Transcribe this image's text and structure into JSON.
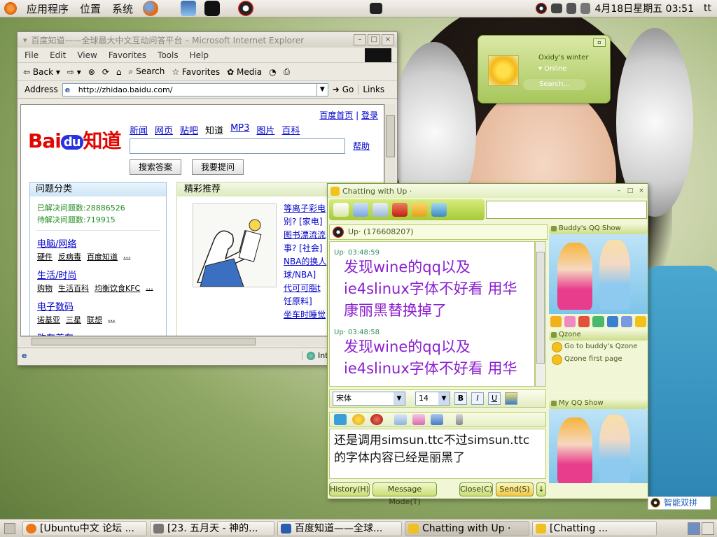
{
  "top_panel": {
    "menus": [
      "应用程序",
      "位置",
      "系统"
    ],
    "date_time": "4月18日星期五 03:51",
    "user": "tt"
  },
  "ie": {
    "title": "百度知道——全球最大中文互动问答平台 – Microsoft Internet Explorer",
    "menu": [
      "File",
      "Edit",
      "View",
      "Favorites",
      "Tools",
      "Help"
    ],
    "toolbar": {
      "back": "Back",
      "search": "Search",
      "favorites": "Favorites",
      "media": "Media"
    },
    "address_label": "Address",
    "address_value": "http://zhidao.baidu.com/",
    "go": "Go",
    "links": "Links",
    "status_zone": "Internet",
    "page": {
      "top_links": [
        "百度首页",
        "登录"
      ],
      "logo": "Bai",
      "logo_du": "du",
      "logo_suffix": "知道",
      "nav": [
        "新闻",
        "网页",
        "贴吧",
        "知道",
        "MP3",
        "图片",
        "百科"
      ],
      "help": "帮助",
      "btn_search": "搜索答案",
      "btn_ask": "我要提问",
      "cat_head": "问题分类",
      "solved": "已解决问题数:28886526",
      "pending": "待解决问题数:719915",
      "categories": [
        {
          "title": "电脑/网络",
          "items": [
            "硬件",
            "反病毒",
            "百度知道",
            "..."
          ]
        },
        {
          "title": "生活/时尚",
          "items": [
            "购物",
            "生活百科",
            "均衡饮食KFC",
            "..."
          ]
        },
        {
          "title": "电子数码",
          "items": [
            "诺基亚",
            "三星",
            "联想",
            "..."
          ]
        },
        {
          "title": "购车养车",
          "items": []
        }
      ],
      "rec_head": "精彩推荐",
      "rec_links": [
        "等离子彩电",
        "别? [家电]",
        "图书漂流流",
        "事? [社会]",
        "NBA的换人",
        "球/NBA]",
        "代可可脂t",
        "饪原料]",
        "坐车时睡觉"
      ]
    }
  },
  "qq_mini": {
    "nick": "Oxidy's winter",
    "status": "Online",
    "search": "Search..."
  },
  "chat": {
    "title": "Chatting with  Up ·",
    "peer": "Up· (176608207)",
    "messages": [
      {
        "head": "Up· 03:48:59",
        "text": "发现wine的qq以及ie4slinux字体不好看 用华康丽黑替换掉了"
      },
      {
        "head": "Up· 03:48:58",
        "text": "发现wine的qq以及ie4slinux字体不好看 用华"
      }
    ],
    "font": "宋体",
    "size": "14",
    "compose_text": "还是调用simsun.ttc不过simsun.ttc的字体内容已经是丽黑了",
    "buttons": {
      "history": "History(H)",
      "message_mode": "Message Mode(T)",
      "close": "Close(C)",
      "send": "Send(S)"
    },
    "side": {
      "buddy_show": "Buddy's QQ Show",
      "qzone": "Qzone",
      "qzone_go": "Go to buddy's Qzone",
      "qzone_first": "Qzone first page",
      "my_show": "My QQ Show"
    }
  },
  "ime": "智能双拼",
  "taskbar": [
    {
      "label": "[Ubuntu中文 论坛 ...",
      "icon_color": "#e8781e"
    },
    {
      "label": "[23. 五月天 - 神的...",
      "icon_color": "#777777"
    },
    {
      "label": "百度知道——全球...",
      "icon_color": "#2a5db0"
    },
    {
      "label": "Chatting with  Up ·",
      "icon_color": "#f0c020"
    },
    {
      "label": "[Chatting ...",
      "icon_color": "#f0c020"
    }
  ]
}
